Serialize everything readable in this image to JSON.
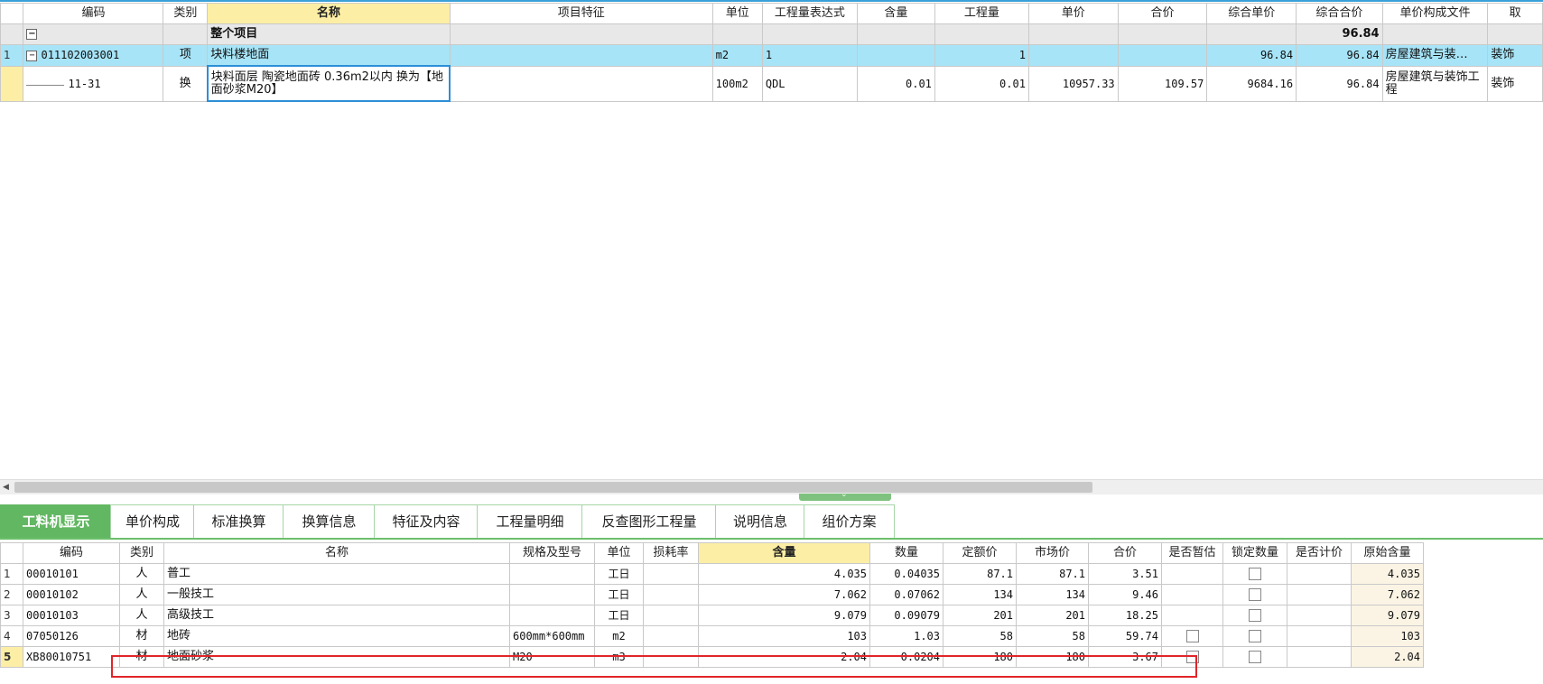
{
  "upper_grid": {
    "headers": [
      "编码",
      "类别",
      "名称",
      "项目特征",
      "单位",
      "工程量表达式",
      "含量",
      "工程量",
      "单价",
      "合价",
      "综合单价",
      "综合合价",
      "单价构成文件",
      "取"
    ],
    "whole_row": {
      "toggle": "−",
      "name": "整个项目",
      "total": "96.84"
    },
    "rows": [
      {
        "no": "1",
        "toggle": "−",
        "code": "011102003001",
        "type": "项",
        "name": "块料楼地面",
        "feature": "",
        "unit": "m2",
        "expr": "1",
        "content": "",
        "qty": "1",
        "price": "",
        "amount": "",
        "comp_price": "96.84",
        "comp_amount": "96.84",
        "file": "房屋建筑与装…",
        "extra": "装饰"
      },
      {
        "no": "",
        "code": "11-31",
        "type": "换",
        "name": "块料面层 陶瓷地面砖 0.36m2以内  换为【地面砂浆M20】",
        "feature": "",
        "unit": "100m2",
        "expr": "QDL",
        "content": "0.01",
        "qty": "0.01",
        "price": "10957.33",
        "amount": "109.57",
        "comp_price": "9684.16",
        "comp_amount": "96.84",
        "file": "房屋建筑与装饰工程",
        "extra": "装饰"
      }
    ]
  },
  "tabs": [
    "工料机显示",
    "单价构成",
    "标准换算",
    "换算信息",
    "特征及内容",
    "工程量明细",
    "反查图形工程量",
    "说明信息",
    "组价方案"
  ],
  "active_tab": "工料机显示",
  "lower_grid": {
    "headers": [
      "编码",
      "类别",
      "名称",
      "规格及型号",
      "单位",
      "损耗率",
      "含量",
      "数量",
      "定额价",
      "市场价",
      "合价",
      "是否暂估",
      "锁定数量",
      "是否计价",
      "原始含量"
    ],
    "rows": [
      {
        "no": "1",
        "code": "00010101",
        "type": "人",
        "name": "普工",
        "spec": "",
        "unit": "工日",
        "loss": "",
        "content": "4.035",
        "qty": "0.04035",
        "quota": "87.1",
        "market": "87.1",
        "amount": "3.51",
        "estimate": false,
        "lock": true,
        "priced": "",
        "orig": "4.035"
      },
      {
        "no": "2",
        "code": "00010102",
        "type": "人",
        "name": "一般技工",
        "spec": "",
        "unit": "工日",
        "loss": "",
        "content": "7.062",
        "qty": "0.07062",
        "quota": "134",
        "market": "134",
        "amount": "9.46",
        "estimate": false,
        "lock": true,
        "priced": "",
        "orig": "7.062"
      },
      {
        "no": "3",
        "code": "00010103",
        "type": "人",
        "name": "高级技工",
        "spec": "",
        "unit": "工日",
        "loss": "",
        "content": "9.079",
        "qty": "0.09079",
        "quota": "201",
        "market": "201",
        "amount": "18.25",
        "estimate": false,
        "lock": true,
        "priced": "",
        "orig": "9.079"
      },
      {
        "no": "4",
        "code": "07050126",
        "type": "材",
        "name": "地砖",
        "spec": "600mm*600mm",
        "unit": "m2",
        "loss": "",
        "content": "103",
        "qty": "1.03",
        "quota": "58",
        "market": "58",
        "amount": "59.74",
        "estimate": true,
        "lock": true,
        "priced": "",
        "orig": "103"
      },
      {
        "no": "5",
        "code": "XB80010751",
        "type": "材",
        "name": "地面砂浆",
        "spec": "M20",
        "unit": "m3",
        "loss": "",
        "content": "2.04",
        "qty": "0.0204",
        "quota": "180",
        "market": "180",
        "amount": "3.67",
        "estimate": true,
        "lock": true,
        "priced": "",
        "orig": "2.04"
      }
    ]
  }
}
